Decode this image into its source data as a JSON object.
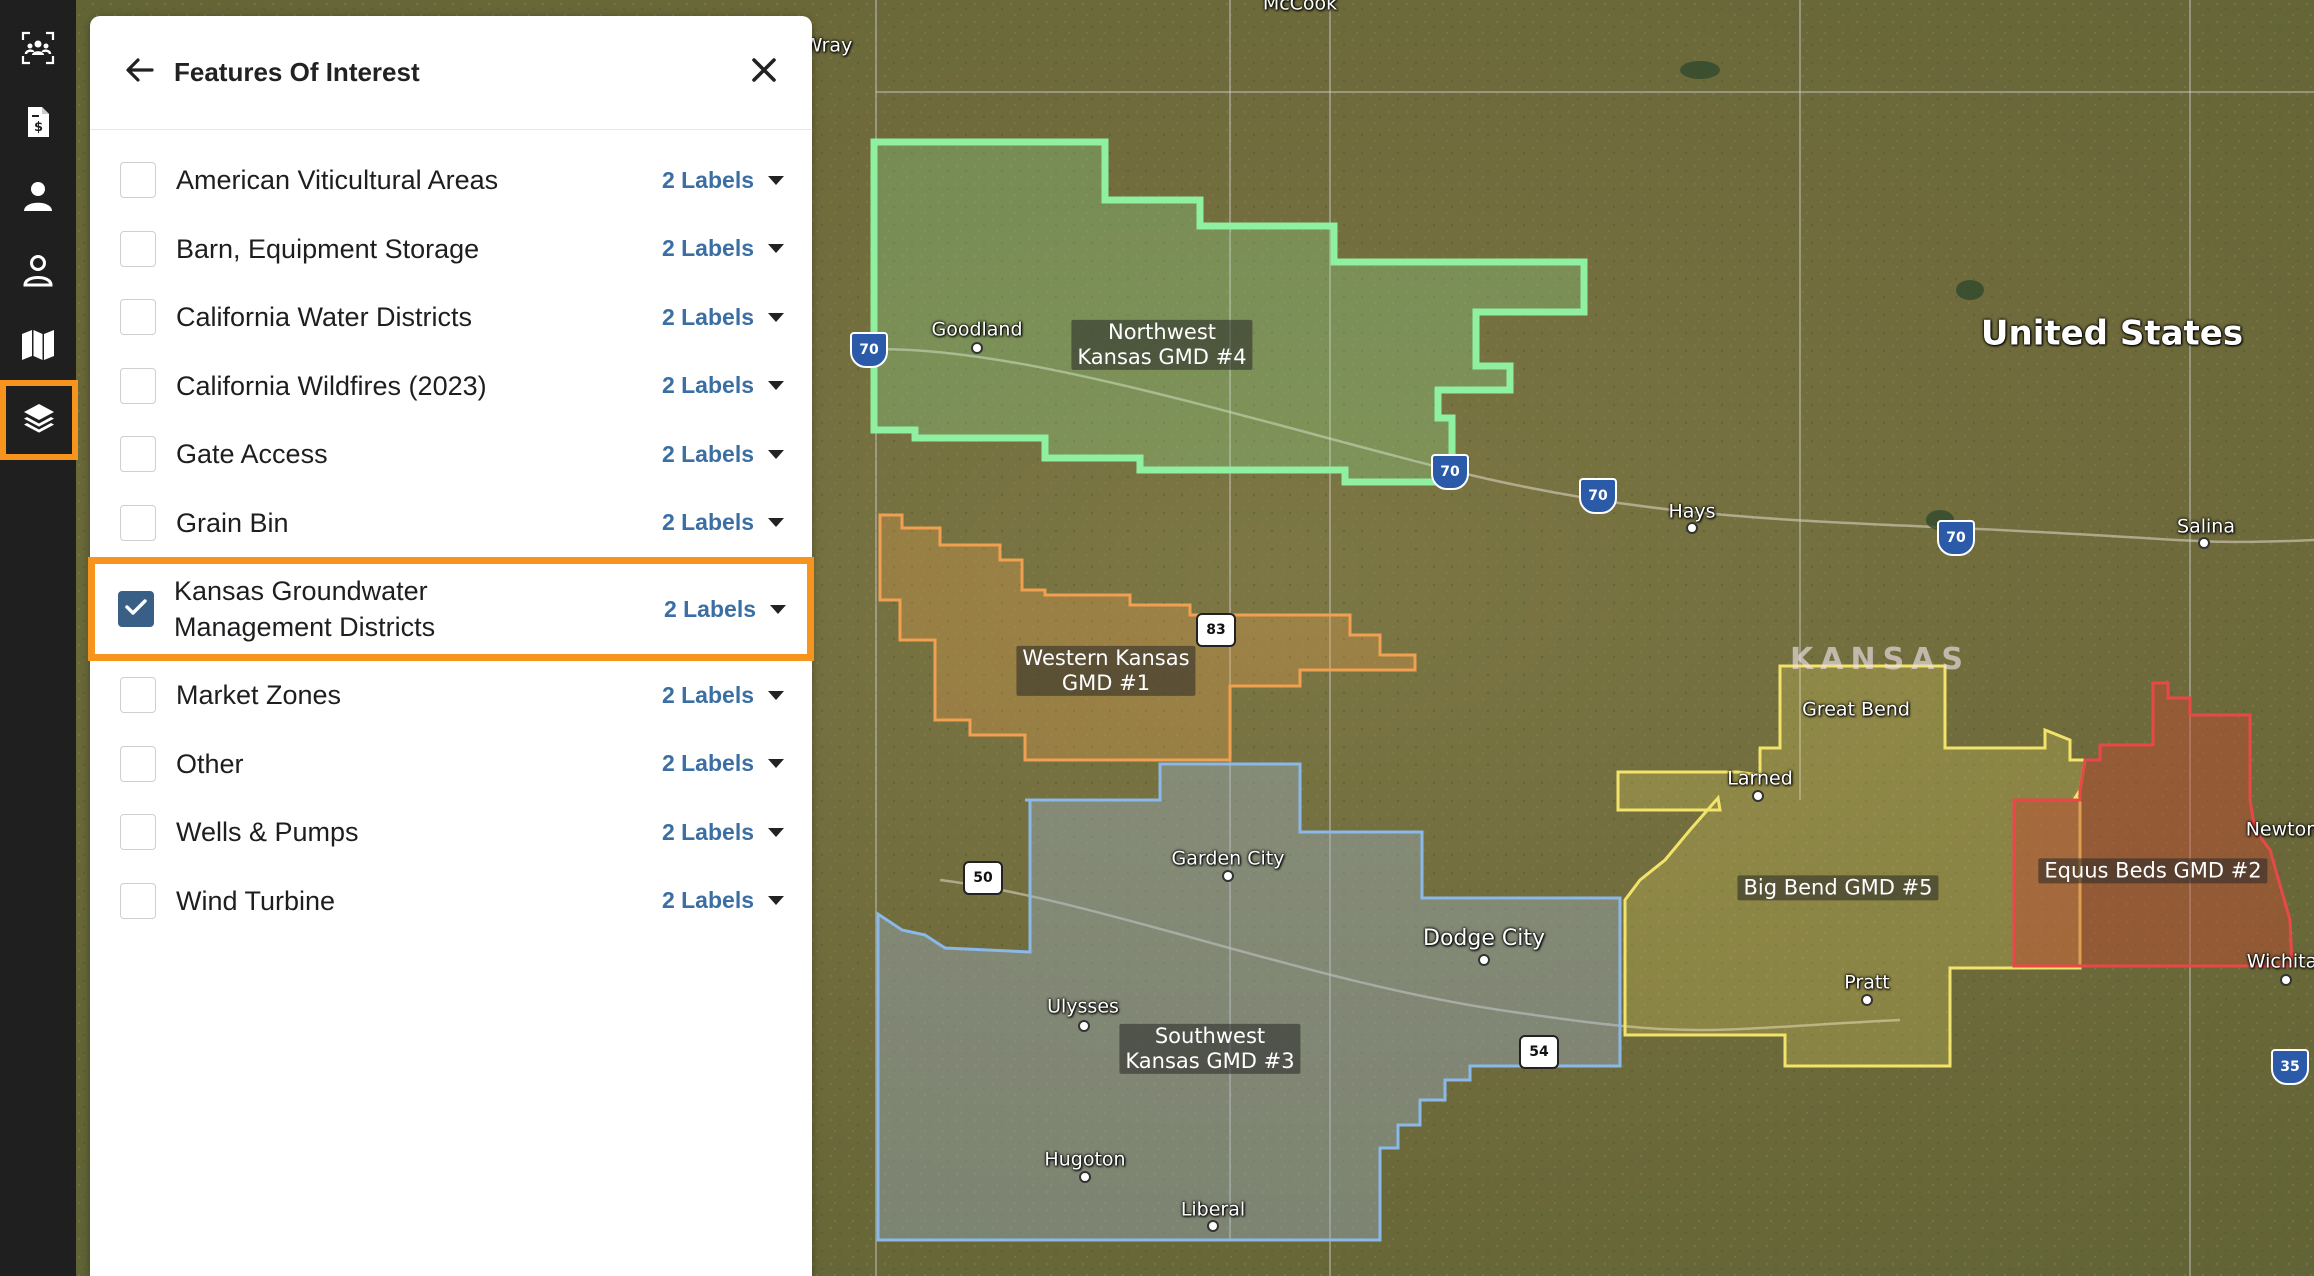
{
  "rail": {
    "items": [
      {
        "icon": "group-icon"
      },
      {
        "icon": "invoice-icon"
      },
      {
        "icon": "user-filled-icon"
      },
      {
        "icon": "user-outline-icon"
      },
      {
        "icon": "map-icon"
      },
      {
        "icon": "layers-icon",
        "active": true
      }
    ]
  },
  "panel": {
    "title": "Features Of Interest",
    "items": [
      {
        "label": "American Viticultural Areas",
        "labels_text": "2 Labels",
        "checked": false
      },
      {
        "label": "Barn, Equipment Storage",
        "labels_text": "2 Labels",
        "checked": false
      },
      {
        "label": "California Water Districts",
        "labels_text": "2 Labels",
        "checked": false
      },
      {
        "label": "California Wildfires (2023)",
        "labels_text": "2 Labels",
        "checked": false
      },
      {
        "label": "Gate Access",
        "labels_text": "2 Labels",
        "checked": false
      },
      {
        "label": "Grain Bin",
        "labels_text": "2 Labels",
        "checked": false
      },
      {
        "label": "Kansas Groundwater\nManagement Districts",
        "labels_text": "2 Labels",
        "checked": true
      },
      {
        "label": "Market Zones",
        "labels_text": "2 Labels",
        "checked": false
      },
      {
        "label": "Other",
        "labels_text": "2 Labels",
        "checked": false
      },
      {
        "label": "Wells & Pumps",
        "labels_text": "2 Labels",
        "checked": false
      },
      {
        "label": "Wind Turbine",
        "labels_text": "2 Labels",
        "checked": false
      }
    ]
  },
  "map": {
    "country_label": "United States",
    "state_label": "KANSAS",
    "districts": [
      {
        "name": "Northwest\nKansas GMD #4",
        "color": "#8ef0a0"
      },
      {
        "name": "Western Kansas\nGMD #1",
        "color": "#f0a050"
      },
      {
        "name": "Southwest\nKansas GMD #3",
        "color": "#8ab8e8"
      },
      {
        "name": "Big Bend GMD #5",
        "color": "#f2e36a"
      },
      {
        "name": "Equus Beds GMD #2",
        "color": "#e84848"
      }
    ],
    "cities": [
      "Goodland",
      "Hays",
      "Salina",
      "Great Bend",
      "Larned",
      "Garden City",
      "Dodge City",
      "Ulysses",
      "Pratt",
      "Hugoton",
      "Liberal",
      "Newton",
      "Wichita",
      "Wray",
      "McCook"
    ],
    "shields": [
      {
        "type": "interstate",
        "number": "70"
      },
      {
        "type": "interstate",
        "number": "70"
      },
      {
        "type": "interstate",
        "number": "70"
      },
      {
        "type": "interstate",
        "number": "70"
      },
      {
        "type": "interstate",
        "number": "35"
      },
      {
        "type": "us",
        "number": "83"
      },
      {
        "type": "us",
        "number": "50"
      },
      {
        "type": "us",
        "number": "54"
      }
    ]
  }
}
